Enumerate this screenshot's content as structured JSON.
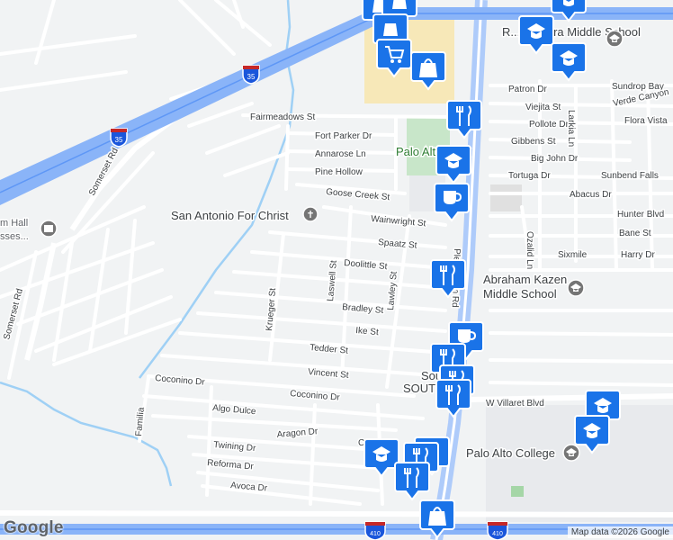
{
  "streets": [
    "Fairmeadows St",
    "Fort Parker Dr",
    "Annarose Ln",
    "Pine Hollow",
    "Goose Creek St",
    "Wainwright St",
    "Spaatz St",
    "Doolittle St",
    "Bradley St",
    "Ike St",
    "Tedder St",
    "Vincent St",
    "Coconino Dr",
    "Coconino Dr",
    "Algo Dulce",
    "Aragon Dr",
    "Twining Dr",
    "Reforma Dr",
    "Avoca Dr",
    "Krueger St",
    "Laswell St",
    "Lawley St",
    "Familia",
    "Somerset Rd",
    "Somerset Rd",
    "Patron Dr",
    "Viejita St",
    "Pollote Dr",
    "Gibbens St",
    "Big John Dr",
    "Tortuga Dr",
    "Abacus Dr",
    "Sixmile",
    "Harry Dr",
    "W Villaret Blvd",
    "Sundrop Bay",
    "Verde Canyon",
    "Flora Vista",
    "Sunbend Falls",
    "Hunter Blvd",
    "Bane St",
    "Ozalid Ln",
    "Larkia Ln",
    "Pleasanton Rd",
    "Co"
  ],
  "places": {
    "church": "San Antonio For Christ",
    "park": "Palo Alto Park",
    "middle_school_line1": "Abraham Kazen",
    "middle_school_line2": "Middle School",
    "college": "Palo Alto College",
    "top_school": "R... Zamora Middle School",
    "left_place_1": "m Hall",
    "left_place_2": "sses...",
    "south_1": "South",
    "south_2": "SOUTH"
  },
  "shields": {
    "i35_top": "35",
    "i35_mid": "35",
    "i410_left": "410",
    "i410_right": "410"
  },
  "branding": {
    "logo": "Google",
    "attribution": "Map data ©2026 Google"
  },
  "pins": [
    {
      "icon": "shopping-icon",
      "label": "store"
    },
    {
      "icon": "cart-icon",
      "label": "supermarket"
    },
    {
      "icon": "bag-icon",
      "label": "shop"
    },
    {
      "icon": "restaurant-icon",
      "label": "restaurant"
    },
    {
      "icon": "school-icon",
      "label": "school"
    },
    {
      "icon": "cafe-icon",
      "label": "cafe"
    },
    {
      "icon": "restaurant-icon",
      "label": "restaurant"
    },
    {
      "icon": "cafe-icon",
      "label": "cafe"
    },
    {
      "icon": "restaurant-icon",
      "label": "restaurant"
    },
    {
      "icon": "restaurant-icon",
      "label": "restaurant"
    },
    {
      "icon": "school-icon",
      "label": "school"
    },
    {
      "icon": "restaurant-icon",
      "label": "restaurant"
    },
    {
      "icon": "bag-icon",
      "label": "shop"
    },
    {
      "icon": "school-icon",
      "label": "school"
    },
    {
      "icon": "school-icon",
      "label": "school"
    },
    {
      "icon": "school-icon",
      "label": "school"
    }
  ],
  "colors": {
    "pin_blue": "#1a73e8",
    "highway": "#8ab4f8",
    "water": "#9fd0f5",
    "park": "#c8e6c9",
    "land": "#f1f3f4",
    "commercial": "#f7e8b8"
  }
}
